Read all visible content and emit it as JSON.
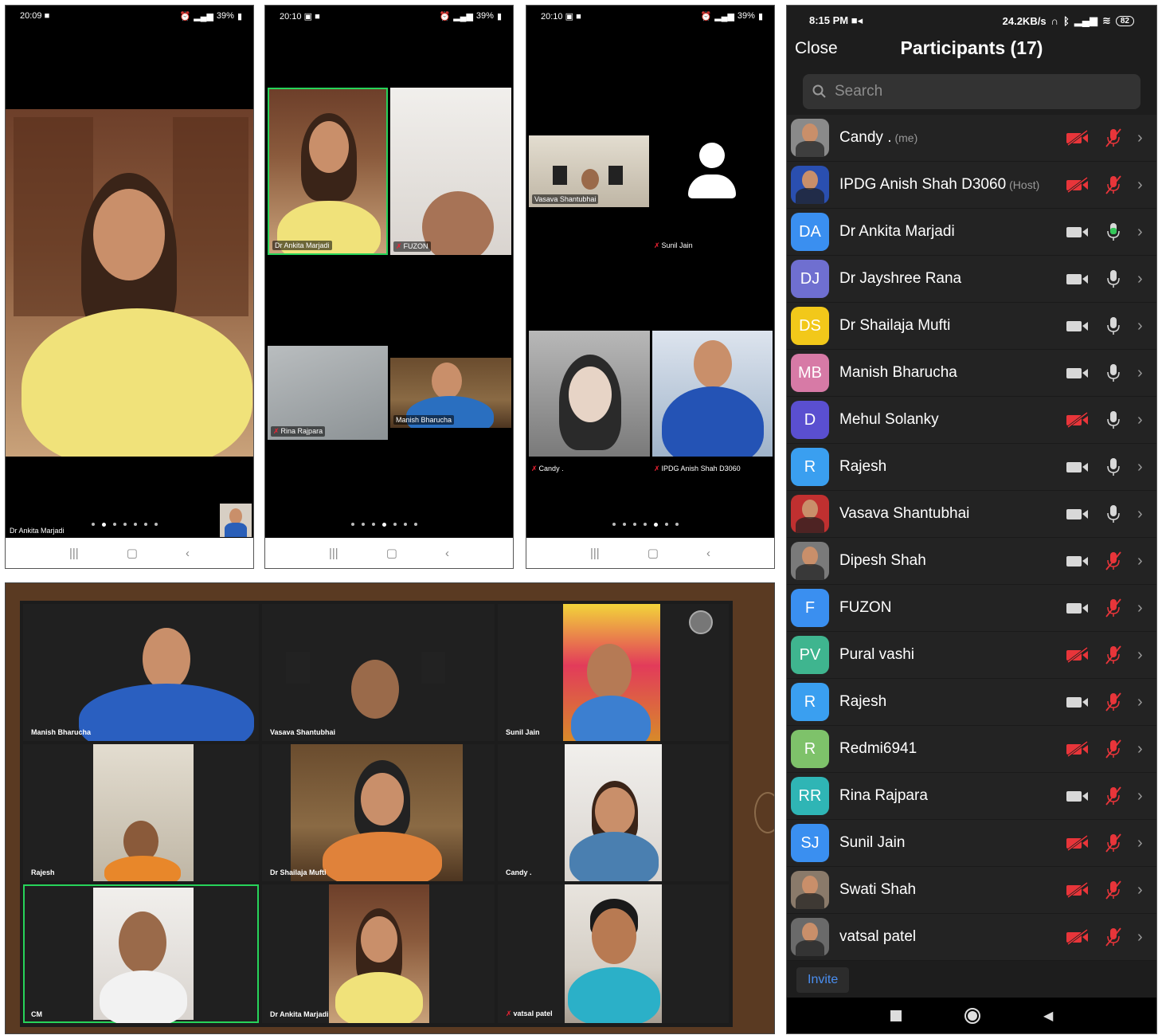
{
  "phone1": {
    "time": "20:09",
    "battery": "39%",
    "main_label": "Dr Ankita Marjadi"
  },
  "phone2": {
    "time": "20:10",
    "battery": "39%",
    "tiles": [
      "Dr Ankita Marjadi",
      "FUZON",
      "Rina Rajpara",
      "Manish Bharucha"
    ]
  },
  "phone3": {
    "time": "20:10",
    "battery": "39%",
    "tiles": [
      "Vasava Shantubhai",
      "Sunil Jain",
      "Candy .",
      "IPDG Anish Shah  D3060"
    ]
  },
  "ipad": {
    "tiles": [
      "Manish Bharucha",
      "Vasava Shantubhai",
      "Sunil Jain",
      "Rajesh",
      "Dr Shailaja Mufti",
      "Candy .",
      "CM",
      "Dr Ankita Marjadi",
      "vatsal patel"
    ]
  },
  "panel": {
    "time": "8:15 PM",
    "net_speed": "24.2KB/s",
    "battery": "82",
    "close_label": "Close",
    "title": "Participants (17)",
    "search_placeholder": "Search",
    "invite_label": "Invite",
    "colors": {
      "muted": "#e8353a",
      "unmuted_green": "#34c759",
      "icon_gray": "#d8d8d8"
    },
    "participants": [
      {
        "name": "Candy .",
        "tag": "(me)",
        "initials": "",
        "avatar_color": "#8a8a8a",
        "video_off": true,
        "mic": "muted"
      },
      {
        "name": "IPDG Anish Shah  D3060",
        "tag": "(Host)",
        "initials": "",
        "avatar_color": "#2a4fb0",
        "video_off": true,
        "mic": "muted"
      },
      {
        "name": "Dr Ankita Marjadi",
        "tag": "",
        "initials": "DA",
        "avatar_color": "#3a8ff0",
        "video_off": false,
        "mic": "active"
      },
      {
        "name": "Dr Jayshree Rana",
        "tag": "",
        "initials": "DJ",
        "avatar_color": "#6f6fd0",
        "video_off": false,
        "mic": "on"
      },
      {
        "name": "Dr Shailaja Mufti",
        "tag": "",
        "initials": "DS",
        "avatar_color": "#f2c81a",
        "video_off": false,
        "mic": "on"
      },
      {
        "name": "Manish Bharucha",
        "tag": "",
        "initials": "MB",
        "avatar_color": "#d77aa6",
        "video_off": false,
        "mic": "on"
      },
      {
        "name": "Mehul Solanky",
        "tag": "",
        "initials": "D",
        "avatar_color": "#5a4fd0",
        "video_off": true,
        "mic": "on"
      },
      {
        "name": "Rajesh",
        "tag": "",
        "initials": "R",
        "avatar_color": "#3a9ff0",
        "video_off": false,
        "mic": "on"
      },
      {
        "name": "Vasava Shantubhai",
        "tag": "",
        "initials": "",
        "avatar_color": "#c03030",
        "video_off": false,
        "mic": "on"
      },
      {
        "name": "Dipesh Shah",
        "tag": "",
        "initials": "",
        "avatar_color": "#7a7a7a",
        "video_off": false,
        "mic": "muted"
      },
      {
        "name": "FUZON",
        "tag": "",
        "initials": "F",
        "avatar_color": "#3a8ff0",
        "video_off": false,
        "mic": "muted"
      },
      {
        "name": "Pural vashi",
        "tag": "",
        "initials": "PV",
        "avatar_color": "#3fb58f",
        "video_off": true,
        "mic": "muted"
      },
      {
        "name": "Rajesh",
        "tag": "",
        "initials": "R",
        "avatar_color": "#3a9ff0",
        "video_off": false,
        "mic": "muted"
      },
      {
        "name": "Redmi6941",
        "tag": "",
        "initials": "R",
        "avatar_color": "#7ec26a",
        "video_off": true,
        "mic": "muted"
      },
      {
        "name": "Rina Rajpara",
        "tag": "",
        "initials": "RR",
        "avatar_color": "#2fb5b5",
        "video_off": false,
        "mic": "muted"
      },
      {
        "name": "Sunil Jain",
        "tag": "",
        "initials": "SJ",
        "avatar_color": "#3a8ff0",
        "video_off": true,
        "mic": "muted"
      },
      {
        "name": "Swati Shah",
        "tag": "",
        "initials": "",
        "avatar_color": "#8a7a6a",
        "video_off": true,
        "mic": "muted"
      },
      {
        "name": "vatsal patel",
        "tag": "",
        "initials": "",
        "avatar_color": "#6a6a6a",
        "video_off": true,
        "mic": "muted"
      }
    ]
  }
}
